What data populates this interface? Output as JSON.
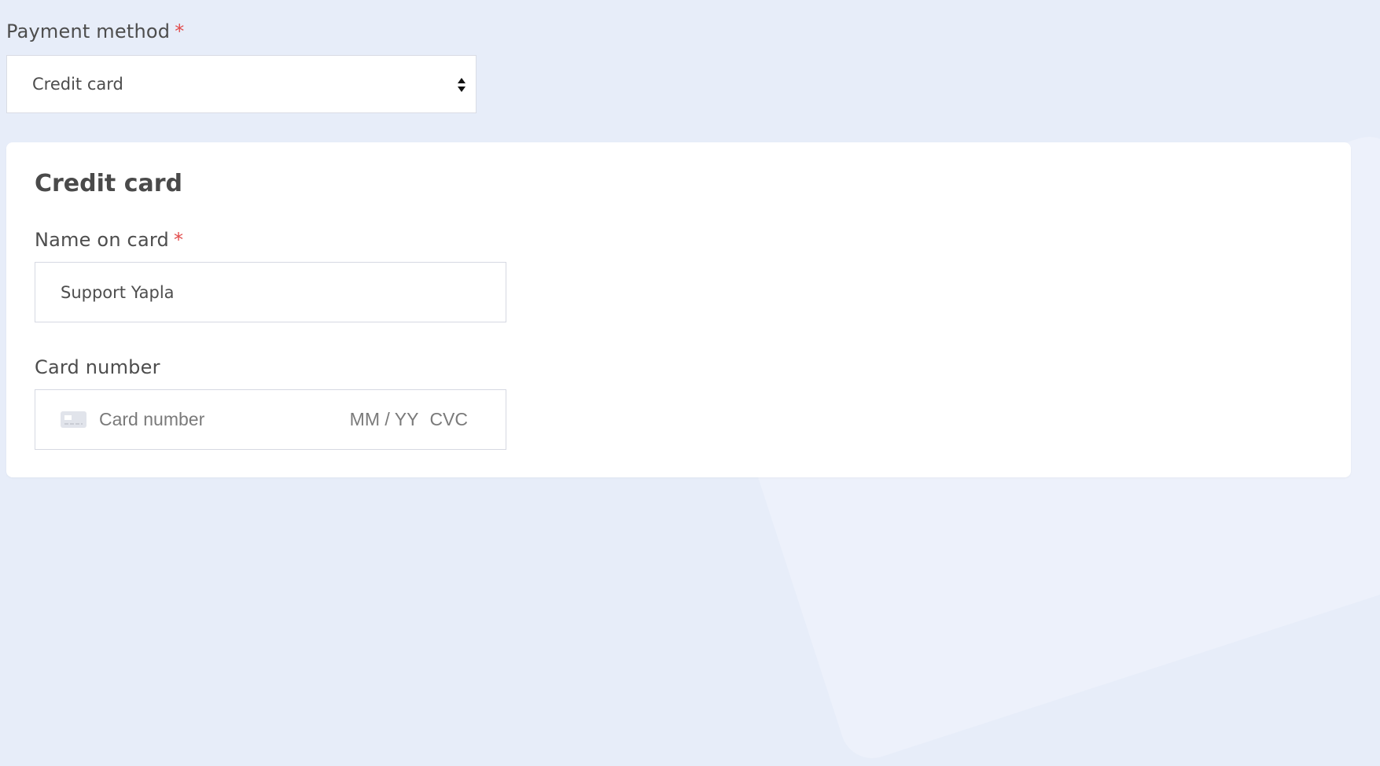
{
  "payment": {
    "label": "Payment method",
    "required_mark": "*",
    "selected": "Credit card"
  },
  "credit_card": {
    "title": "Credit card",
    "name_label": "Name on card",
    "name_required_mark": "*",
    "name_value": "Support Yapla",
    "number_label": "Card number",
    "number_placeholder": "Card number",
    "expiry_placeholder": "MM / YY",
    "cvc_placeholder": "CVC",
    "card_icon": "credit-card-icon"
  },
  "colors": {
    "background": "#e7edf9",
    "panel": "#ffffff",
    "required": "#e24b4b",
    "text": "#4d4d4d"
  }
}
